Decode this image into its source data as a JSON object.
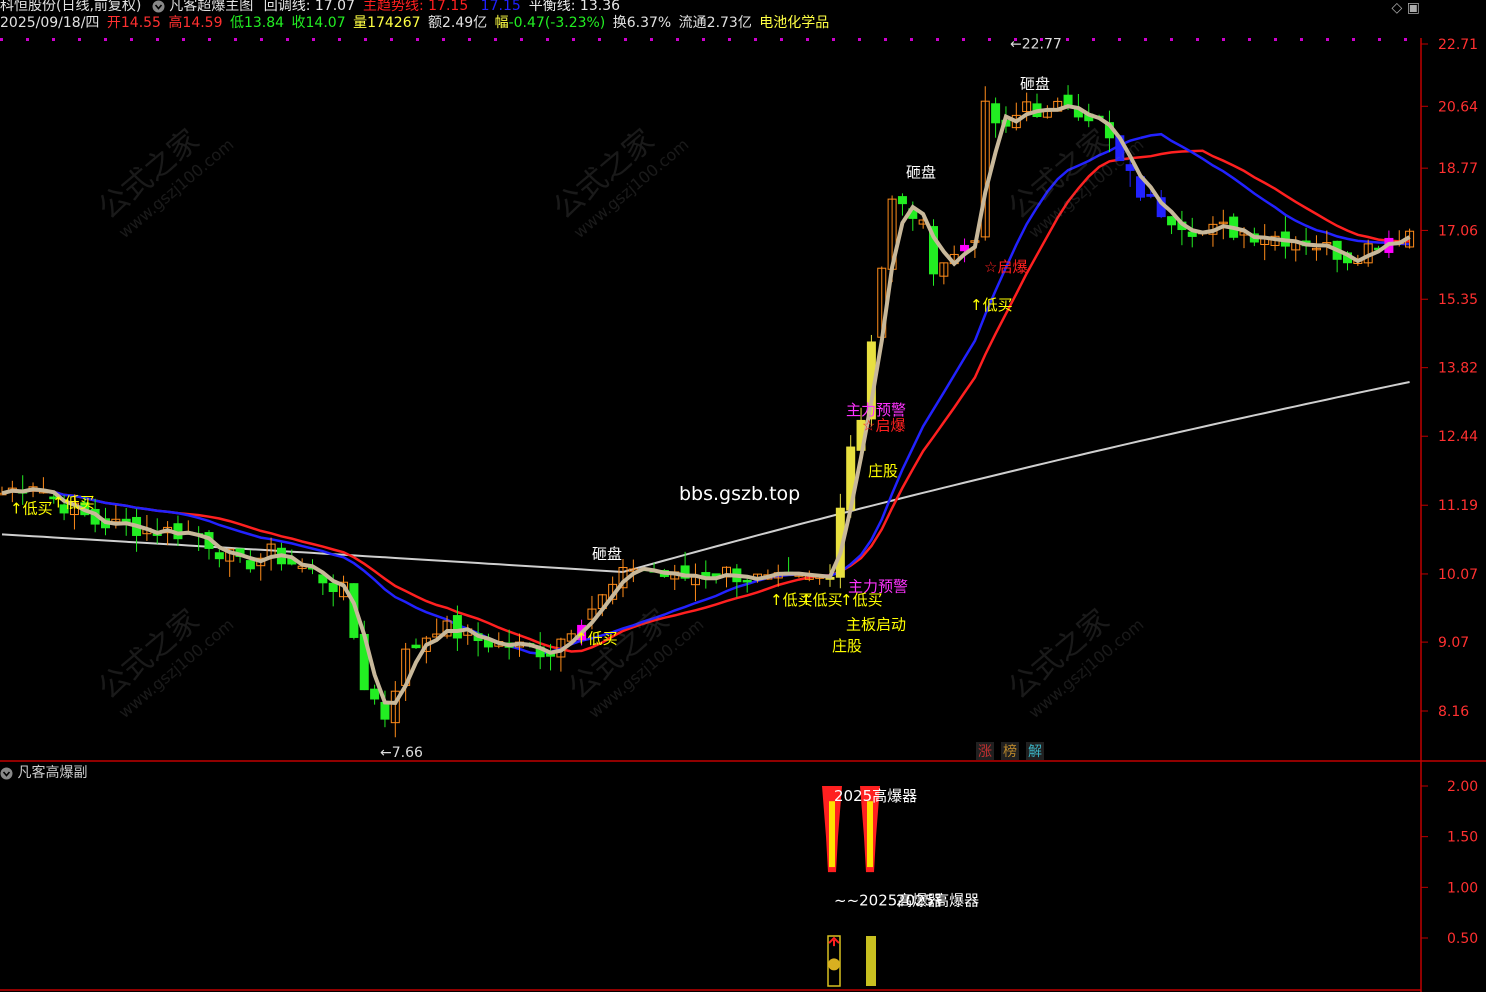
{
  "header": {
    "stock_name": "科恒股份(日线,前复权)",
    "formula_name": "凡客超爆主图",
    "indicators": [
      {
        "label": "回调线:",
        "value": "17.07",
        "color": "#e8e8e8"
      },
      {
        "label": "主趋势线:",
        "value": "17.15",
        "color": "#ff2020"
      },
      {
        "label": "",
        "value": "17.15",
        "color": "#2020ff"
      },
      {
        "label": "平衡线:",
        "value": "13.36",
        "color": "#e8e8e8"
      }
    ],
    "date": "2025/09/18/四",
    "open_label": "开",
    "open": "14.55",
    "high_label": "高",
    "high": "14.59",
    "low_label": "低",
    "low": "13.84",
    "close_label": "收",
    "close": "14.07",
    "vol_label": "量",
    "vol": "174267",
    "amount_label": "额",
    "amount": "2.49亿",
    "change_label": "幅",
    "change": "-0.47(-3.23%)",
    "turnover_label": "换",
    "turnover": "6.37%",
    "float_label": "流通",
    "float": "2.73亿",
    "sector": "电池化学品"
  },
  "sub_panel": {
    "title": "凡客高爆副"
  },
  "watermark": {
    "cn": "公式之家",
    "url": "www.gszj100.com"
  },
  "bbs": "bbs.gszb.top",
  "badges": [
    "涨",
    "榜",
    "解"
  ],
  "colors": {
    "up": "#ff8c1a",
    "down": "#22ee22",
    "red": "#ff2020",
    "blue": "#2222ff",
    "trend": "#c8b89a",
    "yellow": "#ffff00",
    "magenta": "#ff00ff"
  },
  "chart_data": {
    "type": "candlestick",
    "y_ticks": [
      "22.71",
      "20.64",
      "18.77",
      "17.06",
      "15.35",
      "13.82",
      "12.44",
      "11.19",
      "10.07",
      "9.07",
      "8.16"
    ],
    "price_labels": [
      {
        "text": "22.77",
        "value": 22.77
      },
      {
        "text": "7.66",
        "value": 7.66
      }
    ],
    "signal_labels": [
      {
        "text": "↑低买",
        "price": 11.05,
        "color": "#ffff00"
      },
      {
        "text": "↑低买",
        "price": 11.15,
        "color": "#ffff00"
      },
      {
        "text": "砸盘",
        "price": 10.3,
        "color": "#ffffff"
      },
      {
        "text": "↑低买",
        "price": 9.05,
        "color": "#ffff00"
      },
      {
        "text": "↑低买",
        "price": 9.6,
        "color": "#ffff00"
      },
      {
        "text": "↑低买",
        "price": 9.6,
        "color": "#ffff00"
      },
      {
        "text": "主力预警",
        "price": 9.8,
        "color": "#ff33ff"
      },
      {
        "text": "↑低买",
        "price": 9.6,
        "color": "#ffff00"
      },
      {
        "text": "庄股",
        "price": 8.95,
        "color": "#ffff00"
      },
      {
        "text": "主板启动",
        "price": 9.25,
        "color": "#ffff00"
      },
      {
        "text": "庄股",
        "price": 11.7,
        "color": "#ffff00"
      },
      {
        "text": "主力预警",
        "price": 12.85,
        "color": "#ff33ff"
      },
      {
        "text": "☆启爆",
        "price": 12.55,
        "color": "#ff2020"
      },
      {
        "text": "砸盘",
        "price": 18.5,
        "color": "#ffffff"
      },
      {
        "text": "☆启爆",
        "price": 16.0,
        "color": "#ff2020"
      },
      {
        "text": "↑低买",
        "price": 15.1,
        "color": "#ffff00"
      },
      {
        "text": "砸盘",
        "price": 21.2,
        "color": "#ffffff"
      }
    ],
    "sub_y_ticks": [
      "2.00",
      "1.50",
      "1.00",
      "0.50"
    ],
    "sub_labels": [
      {
        "text": "2025高爆器",
        "value": 1.9
      },
      {
        "text": "~~2025高爆器",
        "value": 0.87
      },
      {
        "text": "2025高爆器",
        "value": 0.87
      }
    ]
  }
}
